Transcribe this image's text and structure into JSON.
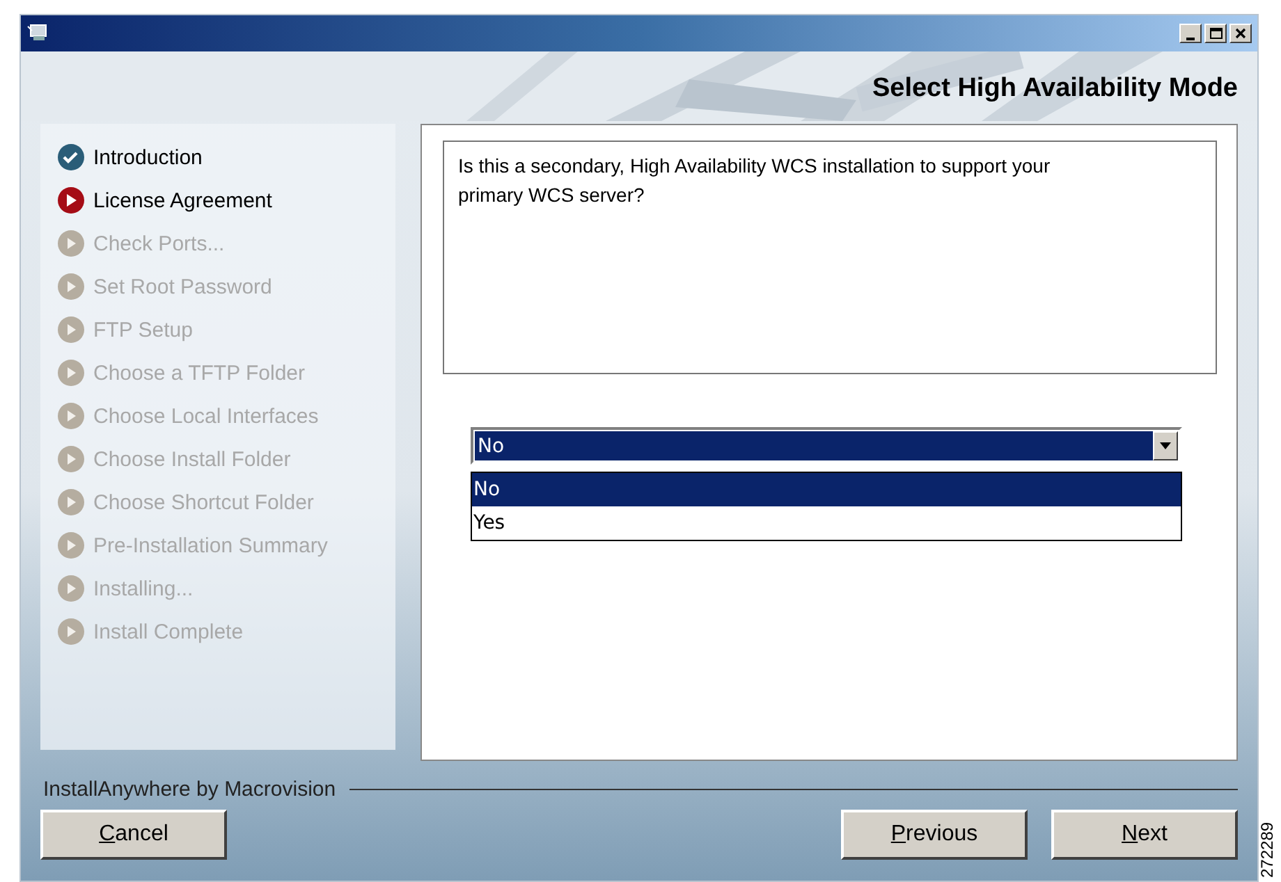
{
  "header": {
    "title": "Select High Availability Mode"
  },
  "steps": [
    {
      "label": "Introduction",
      "kind": "done"
    },
    {
      "label": "License Agreement",
      "kind": "current"
    },
    {
      "label": "Check Ports...",
      "kind": "pending"
    },
    {
      "label": "Set Root Password",
      "kind": "pending"
    },
    {
      "label": "FTP Setup",
      "kind": "pending"
    },
    {
      "label": "Choose a TFTP Folder",
      "kind": "pending"
    },
    {
      "label": "Choose Local Interfaces",
      "kind": "pending"
    },
    {
      "label": "Choose Install Folder",
      "kind": "pending"
    },
    {
      "label": "Choose Shortcut Folder",
      "kind": "pending"
    },
    {
      "label": "Pre-Installation Summary",
      "kind": "pending"
    },
    {
      "label": "Installing...",
      "kind": "pending"
    },
    {
      "label": "Install Complete",
      "kind": "pending"
    }
  ],
  "question": "Is this a secondary, High Availability WCS installation to support your primary WCS server?",
  "dropdown": {
    "value": "No",
    "options": [
      {
        "label": "No",
        "selected": true
      },
      {
        "label": "Yes",
        "selected": false
      }
    ]
  },
  "footer": {
    "brand": "InstallAnywhere by Macrovision"
  },
  "left_buttons": [
    "Cancel"
  ],
  "right_buttons": [
    "Previous",
    "Next"
  ],
  "figure_id": "272289"
}
